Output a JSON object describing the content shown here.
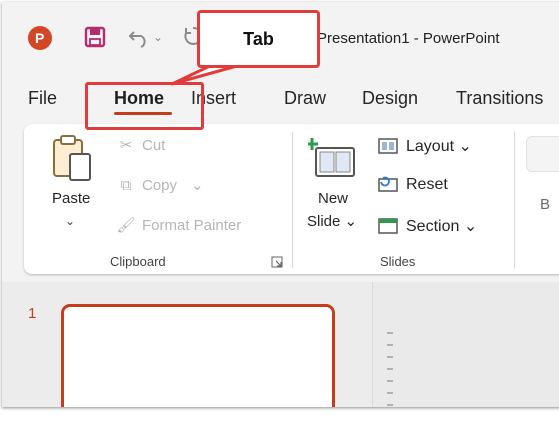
{
  "window": {
    "title": "Presentation1 - PowerPoint"
  },
  "icons": {
    "app": "powerpoint-logo-icon",
    "save": "save-icon",
    "undo": "undo-icon",
    "redo": "redo-icon",
    "paste": "clipboard-paste-icon",
    "cut": "scissors-icon",
    "copy": "copy-icon",
    "format_painter": "paintbrush-icon",
    "new_slide": "new-slide-icon",
    "layout": "layout-icon",
    "reset": "reset-icon",
    "section": "section-icon",
    "dialog_launcher": "dialog-launcher-icon"
  },
  "tabs": [
    {
      "label": "File"
    },
    {
      "label": "Home",
      "active": true
    },
    {
      "label": "Insert"
    },
    {
      "label": "Draw"
    },
    {
      "label": "Design"
    },
    {
      "label": "Transitions"
    }
  ],
  "clipboard": {
    "paste_label": "Paste",
    "cut_label": "Cut",
    "copy_label": "Copy",
    "format_painter_label": "Format Painter",
    "group_label": "Clipboard"
  },
  "slides_group": {
    "new_slide_line1": "New",
    "new_slide_line2": "Slide",
    "layout_label": "Layout",
    "reset_label": "Reset",
    "section_label": "Section",
    "group_label": "Slides"
  },
  "font_group": {
    "bold_label": "B"
  },
  "thumbnails": {
    "slide_number": "1"
  },
  "annotation": {
    "callout_text": "Tab"
  },
  "colors": {
    "accent": "#c43e1c",
    "annotation_red": "#e23b3b",
    "disabled_text": "#b5b5b5"
  }
}
